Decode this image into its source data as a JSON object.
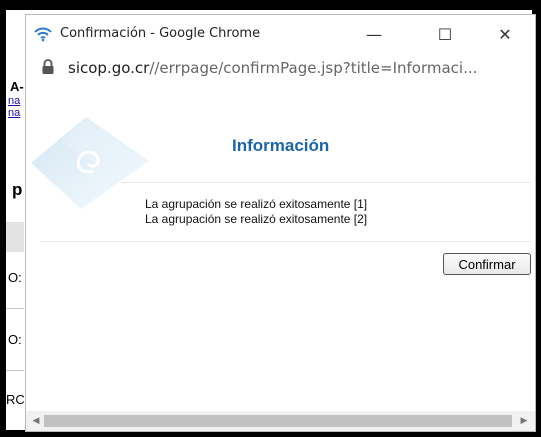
{
  "window": {
    "title": "Confirmación - Google Chrome",
    "minimize": "—",
    "maximize": "☐",
    "close": "✕"
  },
  "address": {
    "host": "sicop.go.cr",
    "path": "//errpage/confirmPage.jsp?title=Informaci..."
  },
  "dialog": {
    "heading": "Información",
    "messages": [
      "La agrupación se realizó exitosamente [1]",
      "La agrupación se realizó exitosamente [2]"
    ],
    "confirm_label": "Confirmar"
  },
  "background_fragments": {
    "a": "A-",
    "link1": "na",
    "link2": "na",
    "p": "p",
    "os1": "O:",
    "os2": "O:",
    "rc": "RC"
  },
  "colors": {
    "heading": "#1c64a8",
    "wifi_icon": "#2a7ad6"
  }
}
